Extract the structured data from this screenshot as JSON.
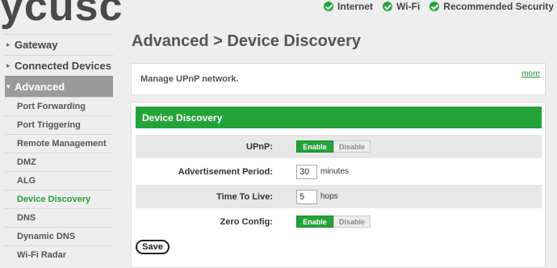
{
  "brand": {
    "logo_text": "ycusc"
  },
  "status": {
    "items": [
      {
        "label": "Internet",
        "icon": "check-circle-icon",
        "color": "#27a43a"
      },
      {
        "label": "Wi-Fi",
        "icon": "check-circle-icon",
        "color": "#27a43a"
      },
      {
        "label": "Recommended Security",
        "icon": "check-circle-icon",
        "color": "#27a43a"
      }
    ]
  },
  "sidebar": {
    "top": [
      {
        "label": "Gateway",
        "caret": "▸"
      },
      {
        "label": "Connected Devices",
        "caret": "▸"
      },
      {
        "label": "Advanced",
        "caret": "▾"
      }
    ],
    "sub": [
      "Port Forwarding",
      "Port Triggering",
      "Remote Management",
      "DMZ",
      "ALG",
      "Device Discovery",
      "DNS",
      "Dynamic DNS",
      "Wi-Fi Radar"
    ],
    "current": "Device Discovery"
  },
  "page": {
    "title": "Advanced > Device Discovery",
    "description": "Manage UPnP network.",
    "more_link": "more"
  },
  "panel": {
    "title": "Device Discovery",
    "upnp": {
      "label": "UPnP:",
      "enable": "Enable",
      "disable": "Disable",
      "selected": "Enable"
    },
    "advertisement": {
      "label": "Advertisement Period:",
      "value": "30",
      "unit": "minutes"
    },
    "ttl": {
      "label": "Time To Live:",
      "value": "5",
      "unit": "hops"
    },
    "zeroconf": {
      "label": "Zero Config:",
      "enable": "Enable",
      "disable": "Disable",
      "selected": "Enable"
    },
    "save_label": "Save"
  },
  "colors": {
    "accent": "#24a33a",
    "active_nav": "#9b9b9b",
    "link": "#2a8c3a"
  }
}
